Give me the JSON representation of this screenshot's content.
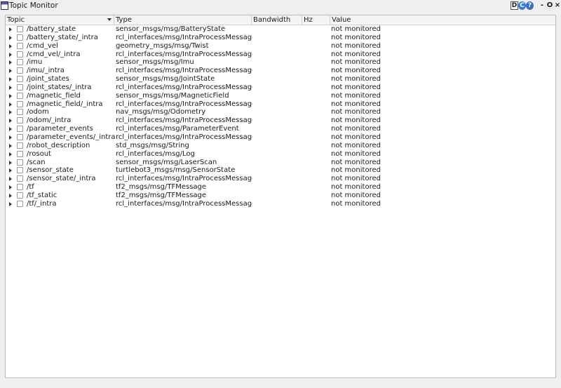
{
  "window": {
    "title": "Topic Monitor",
    "buttons": {
      "d": "D",
      "reload": "C",
      "help": "?",
      "minimize": "-",
      "options": "O",
      "close": "×"
    }
  },
  "columns": {
    "topic": "Topic",
    "type": "Type",
    "bandwidth": "Bandwidth",
    "hz": "Hz",
    "value": "Value"
  },
  "rows": [
    {
      "topic": "/battery_state",
      "type": "sensor_msgs/msg/BatteryState",
      "bandwidth": "",
      "hz": "",
      "value": "not monitored"
    },
    {
      "topic": "/battery_state/_intra",
      "type": "rcl_interfaces/msg/IntraProcessMessage",
      "bandwidth": "",
      "hz": "",
      "value": "not monitored"
    },
    {
      "topic": "/cmd_vel",
      "type": "geometry_msgs/msg/Twist",
      "bandwidth": "",
      "hz": "",
      "value": "not monitored"
    },
    {
      "topic": "/cmd_vel/_intra",
      "type": "rcl_interfaces/msg/IntraProcessMessage",
      "bandwidth": "",
      "hz": "",
      "value": "not monitored"
    },
    {
      "topic": "/imu",
      "type": "sensor_msgs/msg/Imu",
      "bandwidth": "",
      "hz": "",
      "value": "not monitored"
    },
    {
      "topic": "/imu/_intra",
      "type": "rcl_interfaces/msg/IntraProcessMessage",
      "bandwidth": "",
      "hz": "",
      "value": "not monitored"
    },
    {
      "topic": "/joint_states",
      "type": "sensor_msgs/msg/JointState",
      "bandwidth": "",
      "hz": "",
      "value": "not monitored"
    },
    {
      "topic": "/joint_states/_intra",
      "type": "rcl_interfaces/msg/IntraProcessMessage",
      "bandwidth": "",
      "hz": "",
      "value": "not monitored"
    },
    {
      "topic": "/magnetic_field",
      "type": "sensor_msgs/msg/MagneticField",
      "bandwidth": "",
      "hz": "",
      "value": "not monitored"
    },
    {
      "topic": "/magnetic_field/_intra",
      "type": "rcl_interfaces/msg/IntraProcessMessage",
      "bandwidth": "",
      "hz": "",
      "value": "not monitored"
    },
    {
      "topic": "/odom",
      "type": "nav_msgs/msg/Odometry",
      "bandwidth": "",
      "hz": "",
      "value": "not monitored"
    },
    {
      "topic": "/odom/_intra",
      "type": "rcl_interfaces/msg/IntraProcessMessage",
      "bandwidth": "",
      "hz": "",
      "value": "not monitored"
    },
    {
      "topic": "/parameter_events",
      "type": "rcl_interfaces/msg/ParameterEvent",
      "bandwidth": "",
      "hz": "",
      "value": "not monitored"
    },
    {
      "topic": "/parameter_events/_intra",
      "type": "rcl_interfaces/msg/IntraProcessMessage",
      "bandwidth": "",
      "hz": "",
      "value": "not monitored"
    },
    {
      "topic": "/robot_description",
      "type": "std_msgs/msg/String",
      "bandwidth": "",
      "hz": "",
      "value": "not monitored"
    },
    {
      "topic": "/rosout",
      "type": "rcl_interfaces/msg/Log",
      "bandwidth": "",
      "hz": "",
      "value": "not monitored"
    },
    {
      "topic": "/scan",
      "type": "sensor_msgs/msg/LaserScan",
      "bandwidth": "",
      "hz": "",
      "value": "not monitored"
    },
    {
      "topic": "/sensor_state",
      "type": "turtlebot3_msgs/msg/SensorState",
      "bandwidth": "",
      "hz": "",
      "value": "not monitored"
    },
    {
      "topic": "/sensor_state/_intra",
      "type": "rcl_interfaces/msg/IntraProcessMessage",
      "bandwidth": "",
      "hz": "",
      "value": "not monitored"
    },
    {
      "topic": "/tf",
      "type": "tf2_msgs/msg/TFMessage",
      "bandwidth": "",
      "hz": "",
      "value": "not monitored"
    },
    {
      "topic": "/tf_static",
      "type": "tf2_msgs/msg/TFMessage",
      "bandwidth": "",
      "hz": "",
      "value": "not monitored"
    },
    {
      "topic": "/tf/_intra",
      "type": "rcl_interfaces/msg/IntraProcessMessage",
      "bandwidth": "",
      "hz": "",
      "value": "not monitored"
    }
  ]
}
